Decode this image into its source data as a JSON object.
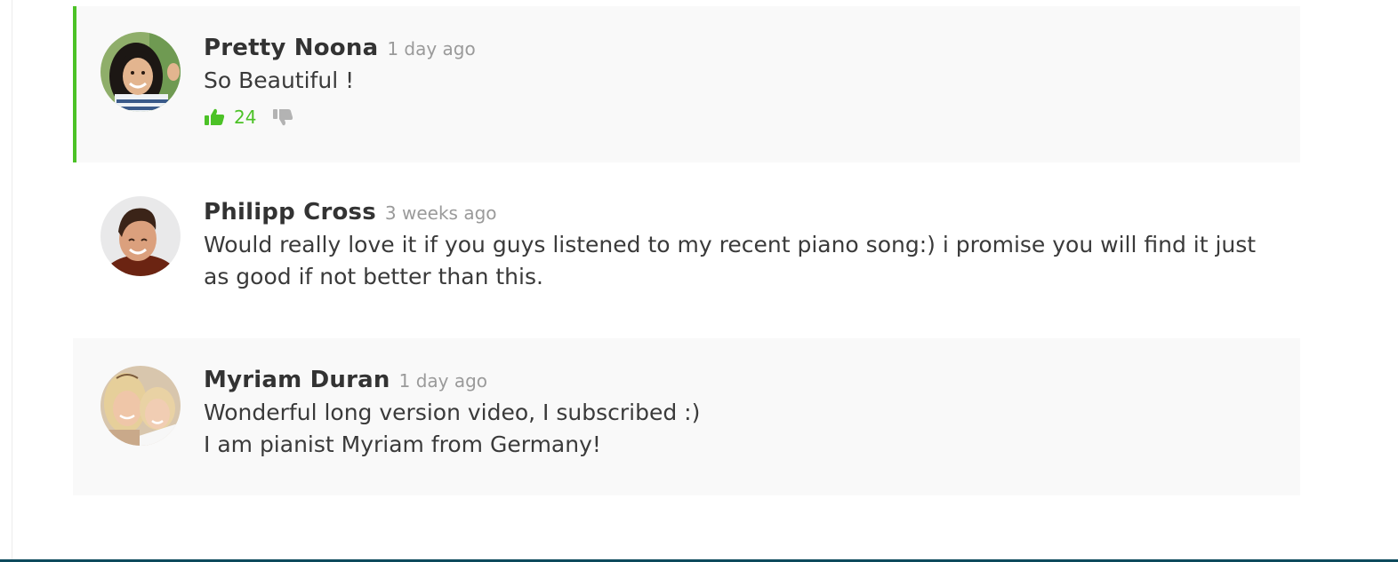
{
  "colors": {
    "accent": "#4cc227",
    "dislike": "#b3b3b3",
    "shaded_background": "#f9f9f9",
    "author_text": "#333333",
    "timestamp_text": "#9a9a9a"
  },
  "comments": [
    {
      "author": "Pretty Noona",
      "time": "1 day ago",
      "text": "So Beautiful !",
      "likes": "24",
      "like_icon": "thumbs-up-icon",
      "dislike_icon": "thumbs-down-icon",
      "highlighted": true
    },
    {
      "author": "Philipp Cross",
      "time": "3 weeks ago",
      "text": "Would really love it if you guys listened to my recent piano song:) i promise you will find it just as good if not better than this."
    },
    {
      "author": "Myriam Duran",
      "time": "1 day ago",
      "text": "Wonderful long version video, I subscribed :)\nI am pianist Myriam from Germany!"
    }
  ]
}
